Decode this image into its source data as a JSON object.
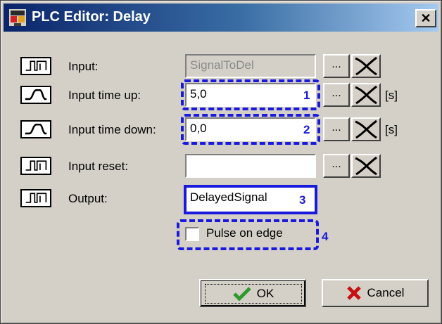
{
  "window": {
    "title": "PLC Editor: Delay",
    "close_glyph": "✕"
  },
  "rows": [
    {
      "label": "Input:",
      "value": "SignalToDel",
      "icon": "digital-signal-icon"
    },
    {
      "label": "Input time up:",
      "value": "5,0",
      "marker": "1",
      "unit": "[s]",
      "icon": "analog-signal-icon"
    },
    {
      "label": "Input time down:",
      "value": "0,0",
      "marker": "2",
      "unit": "[s]",
      "icon": "analog-signal-icon"
    },
    {
      "label": "Input reset:",
      "value": "",
      "icon": "digital-signal-icon"
    },
    {
      "label": "Output:",
      "value": "DelayedSignal",
      "marker": "3",
      "icon": "digital-signal-icon"
    }
  ],
  "browse_label": "...",
  "pulse_on_edge": {
    "label": "Pulse on edge",
    "checked": false,
    "marker": "4"
  },
  "buttons": {
    "ok": "OK",
    "cancel": "Cancel"
  },
  "colors": {
    "annotation": "#1a1adc",
    "title_bar": "#0a246a",
    "ok_check": "#2e9a2e",
    "cancel_x": "#c81010"
  }
}
